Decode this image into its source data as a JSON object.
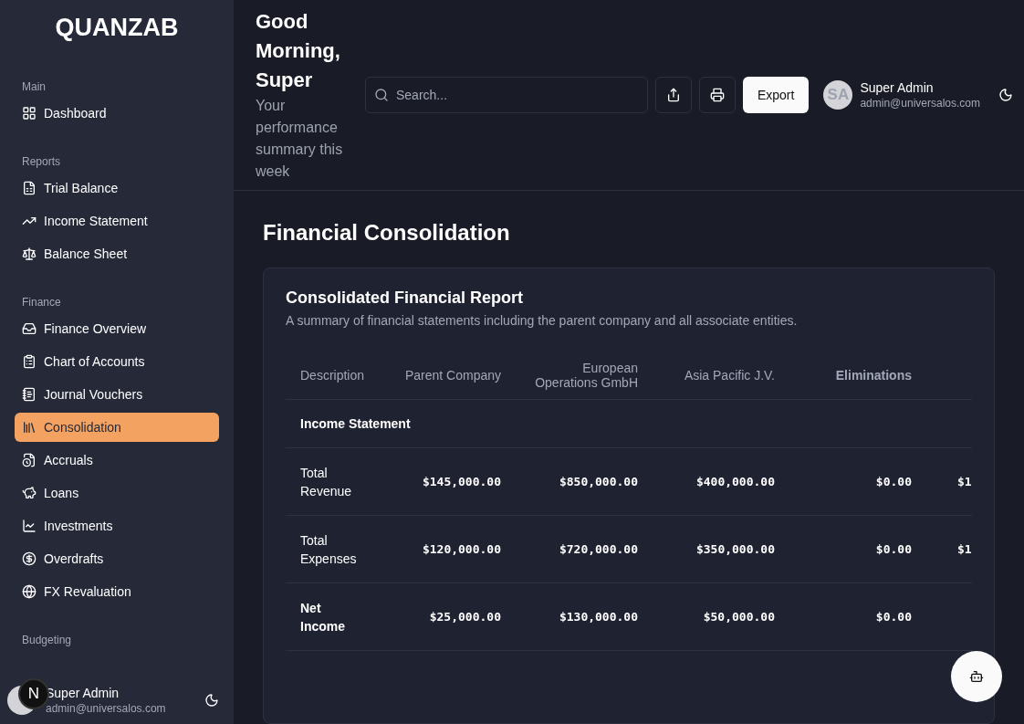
{
  "brand": "QUANZAB",
  "sidebar": {
    "sections": [
      {
        "title": "Main",
        "items": [
          {
            "label": "Dashboard",
            "selected": false
          }
        ]
      },
      {
        "title": "Reports",
        "items": [
          {
            "label": "Trial Balance",
            "selected": false
          },
          {
            "label": "Income Statement",
            "selected": false
          },
          {
            "label": "Balance Sheet",
            "selected": false
          }
        ]
      },
      {
        "title": "Finance",
        "items": [
          {
            "label": "Finance Overview",
            "selected": false
          },
          {
            "label": "Chart of Accounts",
            "selected": false
          },
          {
            "label": "Journal Vouchers",
            "selected": false
          },
          {
            "label": "Consolidation",
            "selected": true
          },
          {
            "label": "Accruals",
            "selected": false
          },
          {
            "label": "Loans",
            "selected": false
          },
          {
            "label": "Investments",
            "selected": false
          },
          {
            "label": "Overdrafts",
            "selected": false
          },
          {
            "label": "FX Revaluation",
            "selected": false
          }
        ]
      },
      {
        "title": "Budgeting"
      }
    ],
    "user": {
      "name": "Super Admin",
      "email": "admin@universalos.com"
    },
    "dev_badge": "N"
  },
  "header": {
    "greeting": "Good Morning, Super",
    "subtitle": "Your performance summary this week",
    "search": {
      "placeholder": "Search..."
    },
    "export_label": "Export",
    "user": {
      "initials": "SA",
      "name": "Super Admin",
      "email": "admin@universalos.com"
    }
  },
  "page_title": "Financial Consolidation",
  "report": {
    "title": "Consolidated Financial Report",
    "description": "A summary of financial statements including the parent company and all associate entities.",
    "columns": [
      {
        "label": "Description",
        "bold": false
      },
      {
        "label": "Parent Company",
        "bold": false
      },
      {
        "label": "European Operations GmbH",
        "bold": false
      },
      {
        "label": "Asia Pacific J.V.",
        "bold": false
      },
      {
        "label": "Eliminations",
        "bold": true
      }
    ],
    "rows": [
      {
        "kind": "section",
        "cells": [
          "Income Statement"
        ]
      },
      {
        "kind": "line",
        "cells": [
          "Total Revenue",
          "$145,000.00",
          "$850,000.00",
          "$400,000.00",
          "$0.00",
          "$1"
        ]
      },
      {
        "kind": "line",
        "cells": [
          "Total Expenses",
          "$120,000.00",
          "$720,000.00",
          "$350,000.00",
          "$0.00",
          "$1"
        ]
      },
      {
        "kind": "total",
        "cells": [
          "Net Income",
          "$25,000.00",
          "$130,000.00",
          "$50,000.00",
          "$0.00"
        ]
      }
    ]
  }
}
